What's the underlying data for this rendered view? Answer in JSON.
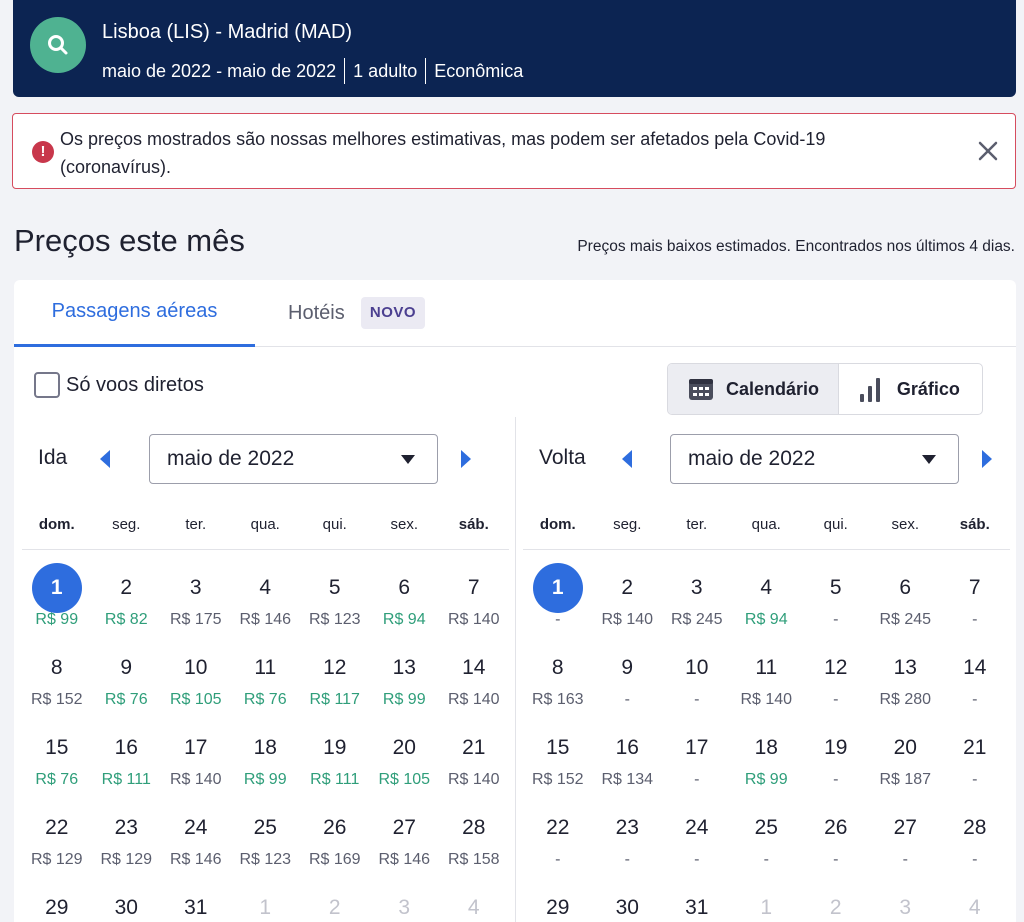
{
  "header": {
    "route": "Lisboa (LIS) - Madrid (MAD)",
    "dates": "maio de 2022 - maio de 2022",
    "travellers": "1 adulto",
    "cabin": "Econômica"
  },
  "alert": {
    "text": "Os preços mostrados são nossas melhores estimativas, mas podem ser afetados pela Covid-19 (coronavírus).",
    "icon": "info-icon",
    "close_icon": "close-icon"
  },
  "section": {
    "title": "Preços este mês",
    "note": "Preços mais baixos estimados. Encontrados nos últimos 4 dias."
  },
  "tabs": {
    "flights": "Passagens aéreas",
    "hotels": "Hotéis",
    "hotels_badge": "NOVO"
  },
  "filters": {
    "direct_label": "Só voos diretos",
    "direct_checked": false
  },
  "view_toggle": {
    "calendar": "Calendário",
    "graph": "Gráfico",
    "active": "calendar"
  },
  "colors": {
    "header_bg": "#0c2452",
    "accent": "#2e6dde",
    "cheap_price": "#2f9e7a",
    "alert_border": "#d64c5e"
  },
  "weekdays": [
    "dom.",
    "seg.",
    "ter.",
    "qua.",
    "qui.",
    "sex.",
    "sáb."
  ],
  "outbound": {
    "label": "Ida",
    "month": "maio de 2022",
    "weeks": [
      [
        {
          "d": "1",
          "p": "R$ 99",
          "c": true,
          "s": true
        },
        {
          "d": "2",
          "p": "R$ 82",
          "c": true
        },
        {
          "d": "3",
          "p": "R$ 175"
        },
        {
          "d": "4",
          "p": "R$ 146"
        },
        {
          "d": "5",
          "p": "R$ 123"
        },
        {
          "d": "6",
          "p": "R$ 94",
          "c": true
        },
        {
          "d": "7",
          "p": "R$ 140"
        }
      ],
      [
        {
          "d": "8",
          "p": "R$ 152"
        },
        {
          "d": "9",
          "p": "R$ 76",
          "c": true
        },
        {
          "d": "10",
          "p": "R$ 105",
          "c": true
        },
        {
          "d": "11",
          "p": "R$ 76",
          "c": true
        },
        {
          "d": "12",
          "p": "R$ 117",
          "c": true
        },
        {
          "d": "13",
          "p": "R$ 99",
          "c": true
        },
        {
          "d": "14",
          "p": "R$ 140"
        }
      ],
      [
        {
          "d": "15",
          "p": "R$ 76",
          "c": true
        },
        {
          "d": "16",
          "p": "R$ 111",
          "c": true
        },
        {
          "d": "17",
          "p": "R$ 140"
        },
        {
          "d": "18",
          "p": "R$ 99",
          "c": true
        },
        {
          "d": "19",
          "p": "R$ 111",
          "c": true
        },
        {
          "d": "20",
          "p": "R$ 105",
          "c": true
        },
        {
          "d": "21",
          "p": "R$ 140"
        }
      ],
      [
        {
          "d": "22",
          "p": "R$ 129"
        },
        {
          "d": "23",
          "p": "R$ 129"
        },
        {
          "d": "24",
          "p": "R$ 146"
        },
        {
          "d": "25",
          "p": "R$ 123"
        },
        {
          "d": "26",
          "p": "R$ 169"
        },
        {
          "d": "27",
          "p": "R$ 146"
        },
        {
          "d": "28",
          "p": "R$ 158"
        }
      ],
      [
        {
          "d": "29",
          "p": ""
        },
        {
          "d": "30",
          "p": ""
        },
        {
          "d": "31",
          "p": ""
        },
        {
          "d": "1",
          "p": "",
          "o": true
        },
        {
          "d": "2",
          "p": "",
          "o": true
        },
        {
          "d": "3",
          "p": "",
          "o": true
        },
        {
          "d": "4",
          "p": "",
          "o": true
        }
      ]
    ]
  },
  "return": {
    "label": "Volta",
    "month": "maio de 2022",
    "weeks": [
      [
        {
          "d": "1",
          "p": "-",
          "s": true
        },
        {
          "d": "2",
          "p": "R$ 140"
        },
        {
          "d": "3",
          "p": "R$ 245"
        },
        {
          "d": "4",
          "p": "R$ 94",
          "c": true
        },
        {
          "d": "5",
          "p": "-"
        },
        {
          "d": "6",
          "p": "R$ 245"
        },
        {
          "d": "7",
          "p": "-"
        }
      ],
      [
        {
          "d": "8",
          "p": "R$ 163"
        },
        {
          "d": "9",
          "p": "-"
        },
        {
          "d": "10",
          "p": "-"
        },
        {
          "d": "11",
          "p": "R$ 140"
        },
        {
          "d": "12",
          "p": "-"
        },
        {
          "d": "13",
          "p": "R$ 280"
        },
        {
          "d": "14",
          "p": "-"
        }
      ],
      [
        {
          "d": "15",
          "p": "R$ 152"
        },
        {
          "d": "16",
          "p": "R$ 134"
        },
        {
          "d": "17",
          "p": "-"
        },
        {
          "d": "18",
          "p": "R$ 99",
          "c": true
        },
        {
          "d": "19",
          "p": "-"
        },
        {
          "d": "20",
          "p": "R$ 187"
        },
        {
          "d": "21",
          "p": "-"
        }
      ],
      [
        {
          "d": "22",
          "p": "-"
        },
        {
          "d": "23",
          "p": "-"
        },
        {
          "d": "24",
          "p": "-"
        },
        {
          "d": "25",
          "p": "-"
        },
        {
          "d": "26",
          "p": "-"
        },
        {
          "d": "27",
          "p": "-"
        },
        {
          "d": "28",
          "p": "-"
        }
      ],
      [
        {
          "d": "29",
          "p": ""
        },
        {
          "d": "30",
          "p": ""
        },
        {
          "d": "31",
          "p": ""
        },
        {
          "d": "1",
          "p": "",
          "o": true
        },
        {
          "d": "2",
          "p": "",
          "o": true
        },
        {
          "d": "3",
          "p": "",
          "o": true
        },
        {
          "d": "4",
          "p": "",
          "o": true
        }
      ]
    ]
  }
}
